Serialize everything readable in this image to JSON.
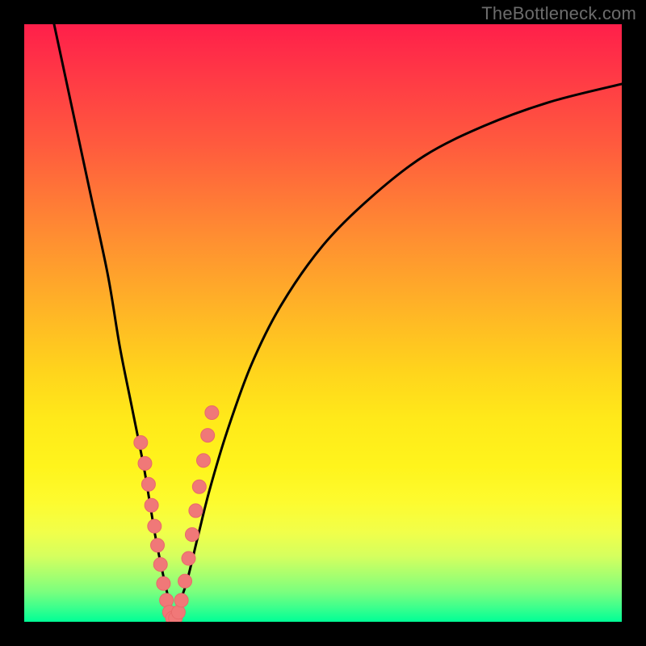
{
  "watermark": "TheBottleneck.com",
  "colors": {
    "curve": "#000000",
    "dots": "#f07878",
    "dot_stroke": "#e86a6a"
  },
  "chart_data": {
    "type": "line",
    "title": "",
    "xlabel": "",
    "ylabel": "",
    "xlim": [
      0,
      100
    ],
    "ylim": [
      0,
      100
    ],
    "grid": false,
    "legend": false,
    "series": [
      {
        "name": "bottleneck-curve-left",
        "x": [
          5,
          8,
          11,
          14,
          16,
          18,
          20,
          21,
          22,
          23,
          24,
          25
        ],
        "y": [
          100,
          86,
          72,
          58,
          46,
          36,
          26,
          20,
          14,
          9,
          4.5,
          1
        ]
      },
      {
        "name": "bottleneck-curve-right",
        "x": [
          25,
          27,
          29,
          31,
          34,
          38,
          43,
          50,
          58,
          67,
          77,
          88,
          100
        ],
        "y": [
          1,
          6,
          14,
          22,
          32,
          43,
          53,
          63,
          71,
          78,
          83,
          87,
          90
        ]
      }
    ],
    "scatter": {
      "name": "sample-points",
      "x": [
        19.5,
        20.2,
        20.8,
        21.3,
        21.8,
        22.3,
        22.8,
        23.3,
        23.8,
        24.3,
        24.8,
        25.3,
        25.8,
        26.3,
        26.9,
        27.5,
        28.1,
        28.7,
        29.3,
        30.0,
        30.7,
        31.4
      ],
      "y": [
        30.0,
        26.5,
        23.0,
        19.5,
        16.0,
        12.8,
        9.6,
        6.4,
        3.6,
        1.6,
        0.6,
        0.6,
        1.6,
        3.6,
        6.8,
        10.6,
        14.6,
        18.6,
        22.6,
        27.0,
        31.2,
        35.0
      ]
    }
  }
}
